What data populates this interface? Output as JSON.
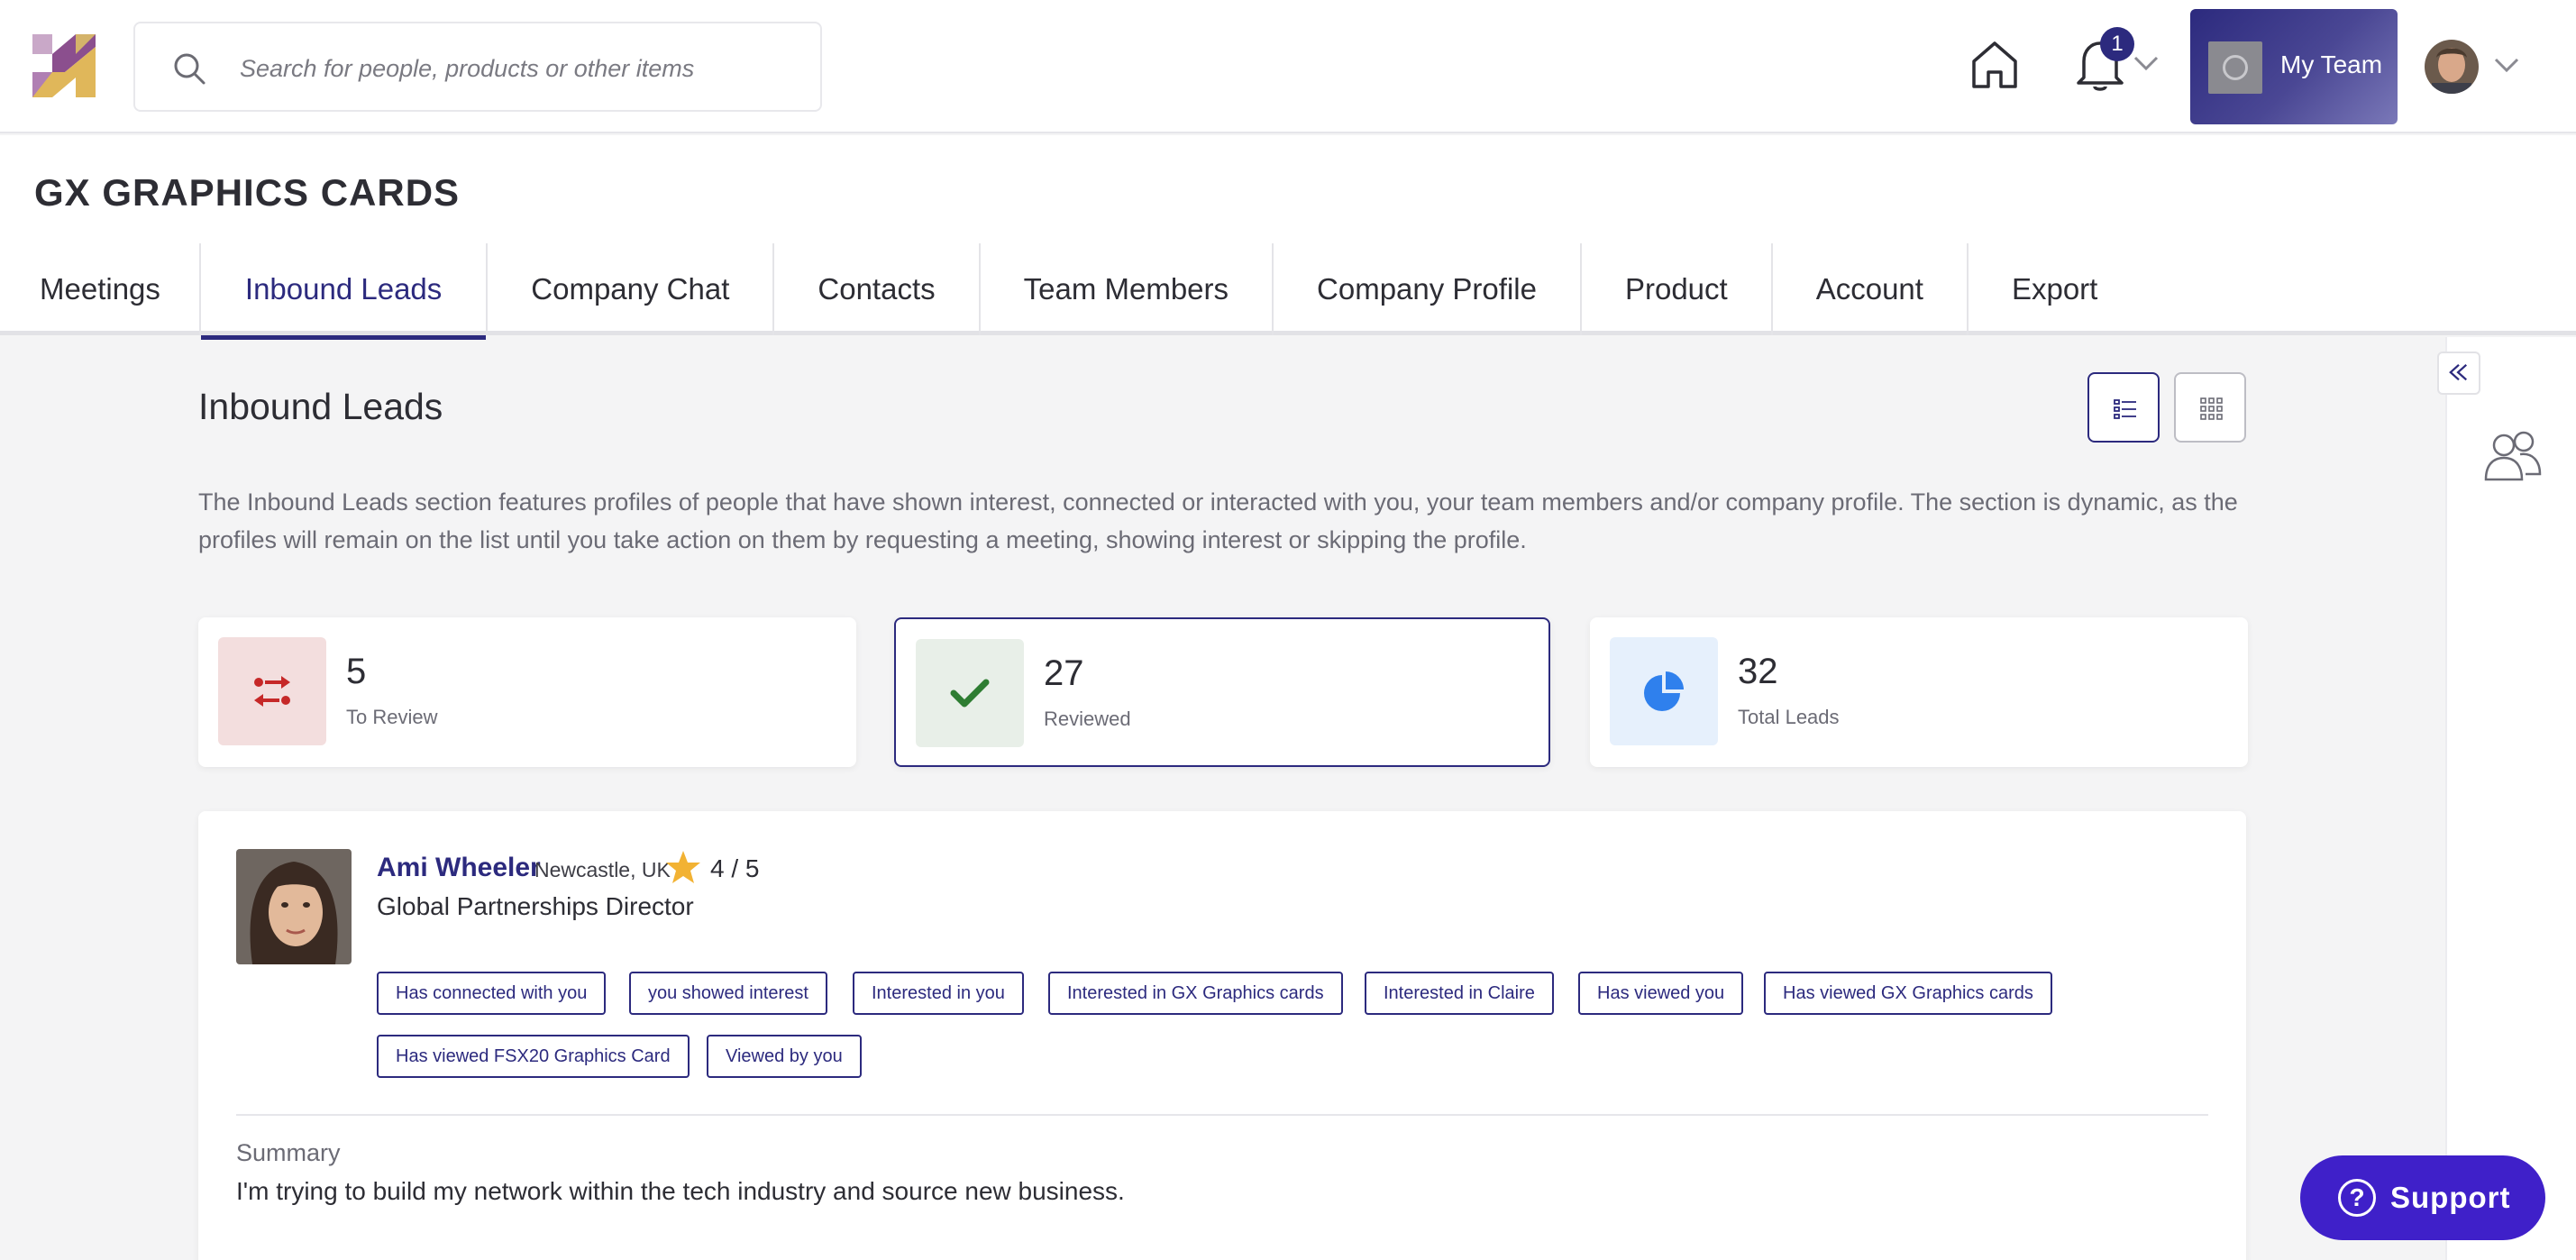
{
  "search": {
    "placeholder": "Search for people, products or other items"
  },
  "header": {
    "notification_count": "1",
    "team_label": "My Team"
  },
  "company": {
    "title": "GX GRAPHICS CARDS"
  },
  "tabs": [
    {
      "label": "Meetings",
      "active": false
    },
    {
      "label": "Inbound Leads",
      "active": true
    },
    {
      "label": "Company Chat",
      "active": false
    },
    {
      "label": "Contacts",
      "active": false
    },
    {
      "label": "Team Members",
      "active": false
    },
    {
      "label": "Company Profile",
      "active": false
    },
    {
      "label": "Product",
      "active": false
    },
    {
      "label": "Account",
      "active": false
    },
    {
      "label": "Export",
      "active": false
    }
  ],
  "main": {
    "title": "Inbound Leads",
    "description": "The Inbound Leads section features profiles of people that have shown interest, connected or interacted with you, your team members and/or company profile. The section is dynamic, as the profiles will remain on the list until you take action on them by requesting a meeting, showing interest or skipping the profile."
  },
  "stats": [
    {
      "value": "5",
      "label": "To Review",
      "icon": "swap-arrows-icon",
      "color": "#c62828",
      "bg": "#f3dede"
    },
    {
      "value": "27",
      "label": "Reviewed",
      "icon": "checkmark-icon",
      "color": "#2e7d32",
      "bg": "#e8efe8"
    },
    {
      "value": "32",
      "label": "Total Leads",
      "icon": "pie-chart-icon",
      "color": "#2f80ed",
      "bg": "#e6f0fc"
    }
  ],
  "lead": {
    "name": "Ami Wheeler",
    "location": "Newcastle, UK",
    "rating": "4 / 5",
    "role": "Global Partnerships Director",
    "tags": [
      "Has connected with you",
      "you showed interest",
      "Interested in you",
      "Interested in GX Graphics cards",
      "Interested in Claire",
      "Has viewed you",
      "Has viewed GX Graphics cards",
      "Has viewed FSX20 Graphics Card",
      "Viewed by you"
    ],
    "summary_label": "Summary",
    "summary": "I'm trying to build my network within the tech industry and source new business."
  },
  "support": {
    "label": "Support"
  },
  "colors": {
    "brand": "#2c2a7e",
    "support": "#3f20c9"
  }
}
